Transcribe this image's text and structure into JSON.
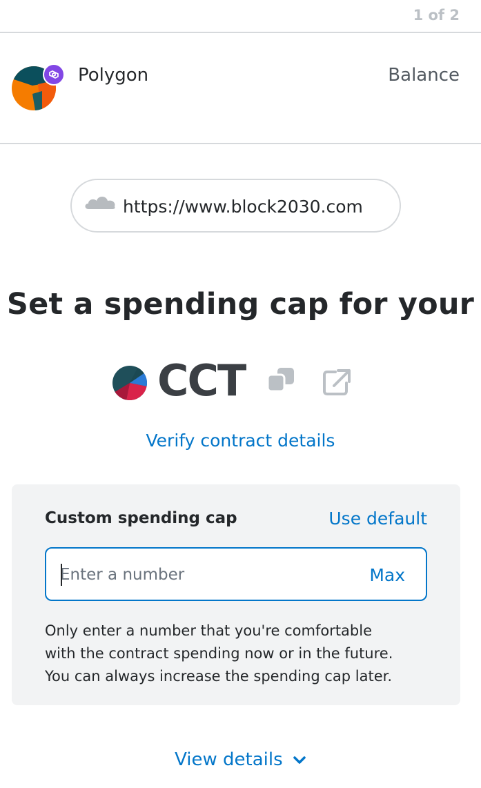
{
  "header": {
    "page_counter": "1 of 2"
  },
  "network": {
    "name": "Polygon",
    "balance_label": "Balance",
    "badge_color": "#8247e5"
  },
  "origin": {
    "url": "https://www.block2030.com",
    "icon": "cloud-icon"
  },
  "title": "Set a spending cap for your",
  "token": {
    "symbol": "CCT",
    "icons": [
      "token-logo-icon",
      "copy-icon",
      "external-link-icon"
    ]
  },
  "verify_link": "Verify contract details",
  "spending_cap": {
    "label": "Custom spending cap",
    "use_default": "Use default",
    "input_value": "",
    "input_placeholder": "Enter a number",
    "max_label": "Max",
    "help_lines": [
      "Only enter a number that you're comfortable",
      "with the contract spending now or in the future.",
      "You can always increase the spending cap later."
    ]
  },
  "view_details": "View details",
  "colors": {
    "accent": "#0376c9",
    "card_background": "#f2f3f4",
    "divider": "#d6d9dc",
    "text": "#24272a"
  }
}
